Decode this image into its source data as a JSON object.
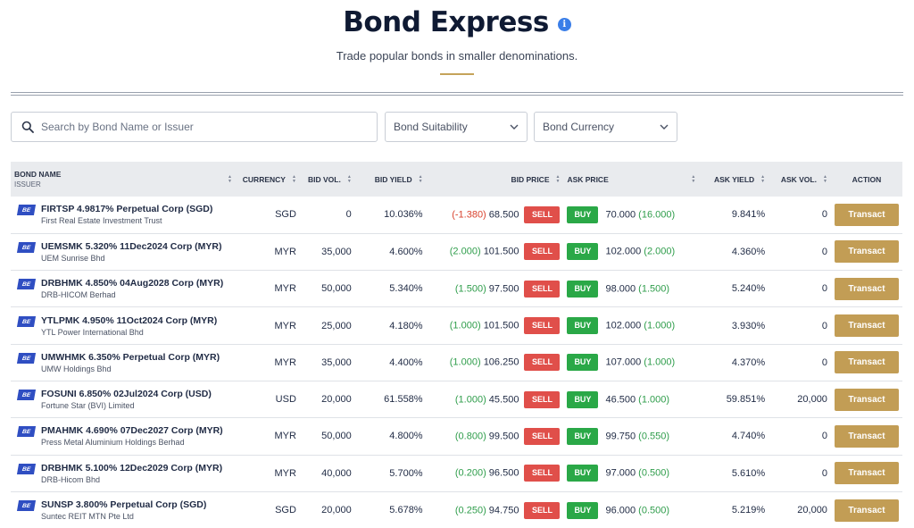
{
  "header": {
    "title": "Bond Express",
    "info_icon": "i",
    "subtitle": "Trade popular bonds in smaller denominations."
  },
  "filters": {
    "search_placeholder": "Search by Bond Name or Issuer",
    "suitability_label": "Bond Suitability",
    "currency_label": "Bond Currency"
  },
  "table": {
    "columns": {
      "bond_name": "BOND NAME",
      "issuer": "ISSUER",
      "currency": "CURRENCY",
      "bid_vol": "BID VOL.",
      "bid_yield": "BID YIELD",
      "bid_price": "BID PRICE",
      "ask_price": "ASK PRICE",
      "ask_yield": "ASK YIELD",
      "ask_vol": "ASK VOL.",
      "action": "ACTION"
    },
    "badge": "BE",
    "sell_label": "SELL",
    "buy_label": "BUY",
    "transact_label": "Transact",
    "rows": [
      {
        "name": "FIRTSP 4.9817% Perpetual Corp (SGD)",
        "issuer": "First Real Estate Investment Trust",
        "currency": "SGD",
        "bid_vol": "0",
        "bid_yield": "10.036%",
        "bid_change": "(-1.380)",
        "bid_change_dir": "neg",
        "bid_price": "68.500",
        "ask_price": "70.000",
        "ask_change": "(16.000)",
        "ask_yield": "9.841%",
        "ask_vol": "0"
      },
      {
        "name": "UEMSMK 5.320% 11Dec2024 Corp (MYR)",
        "issuer": "UEM Sunrise Bhd",
        "currency": "MYR",
        "bid_vol": "35,000",
        "bid_yield": "4.600%",
        "bid_change": "(2.000)",
        "bid_change_dir": "pos",
        "bid_price": "101.500",
        "ask_price": "102.000",
        "ask_change": "(2.000)",
        "ask_yield": "4.360%",
        "ask_vol": "0"
      },
      {
        "name": "DRBHMK 4.850% 04Aug2028 Corp (MYR)",
        "issuer": "DRB-HICOM Berhad",
        "currency": "MYR",
        "bid_vol": "50,000",
        "bid_yield": "5.340%",
        "bid_change": "(1.500)",
        "bid_change_dir": "pos",
        "bid_price": "97.500",
        "ask_price": "98.000",
        "ask_change": "(1.500)",
        "ask_yield": "5.240%",
        "ask_vol": "0"
      },
      {
        "name": "YTLPMK 4.950% 11Oct2024 Corp (MYR)",
        "issuer": "YTL Power International Bhd",
        "currency": "MYR",
        "bid_vol": "25,000",
        "bid_yield": "4.180%",
        "bid_change": "(1.000)",
        "bid_change_dir": "pos",
        "bid_price": "101.500",
        "ask_price": "102.000",
        "ask_change": "(1.000)",
        "ask_yield": "3.930%",
        "ask_vol": "0"
      },
      {
        "name": "UMWHMK 6.350% Perpetual Corp (MYR)",
        "issuer": "UMW Holdings Bhd",
        "currency": "MYR",
        "bid_vol": "35,000",
        "bid_yield": "4.400%",
        "bid_change": "(1.000)",
        "bid_change_dir": "pos",
        "bid_price": "106.250",
        "ask_price": "107.000",
        "ask_change": "(1.000)",
        "ask_yield": "4.370%",
        "ask_vol": "0"
      },
      {
        "name": "FOSUNI 6.850% 02Jul2024 Corp (USD)",
        "issuer": "Fortune Star (BVI) Limited",
        "currency": "USD",
        "bid_vol": "20,000",
        "bid_yield": "61.558%",
        "bid_change": "(1.000)",
        "bid_change_dir": "pos",
        "bid_price": "45.500",
        "ask_price": "46.500",
        "ask_change": "(1.000)",
        "ask_yield": "59.851%",
        "ask_vol": "20,000"
      },
      {
        "name": "PMAHMK 4.690% 07Dec2027 Corp (MYR)",
        "issuer": "Press Metal Aluminium Holdings Berhad",
        "currency": "MYR",
        "bid_vol": "50,000",
        "bid_yield": "4.800%",
        "bid_change": "(0.800)",
        "bid_change_dir": "pos",
        "bid_price": "99.500",
        "ask_price": "99.750",
        "ask_change": "(0.550)",
        "ask_yield": "4.740%",
        "ask_vol": "0"
      },
      {
        "name": "DRBHMK 5.100% 12Dec2029 Corp (MYR)",
        "issuer": "DRB-Hicom Bhd",
        "currency": "MYR",
        "bid_vol": "40,000",
        "bid_yield": "5.700%",
        "bid_change": "(0.200)",
        "bid_change_dir": "pos",
        "bid_price": "96.500",
        "ask_price": "97.000",
        "ask_change": "(0.500)",
        "ask_yield": "5.610%",
        "ask_vol": "0"
      },
      {
        "name": "SUNSP 3.800% Perpetual Corp (SGD)",
        "issuer": "Suntec REIT MTN Pte Ltd",
        "currency": "SGD",
        "bid_vol": "20,000",
        "bid_yield": "5.678%",
        "bid_change": "(0.250)",
        "bid_change_dir": "pos",
        "bid_price": "94.750",
        "ask_price": "96.000",
        "ask_change": "(0.500)",
        "ask_yield": "5.219%",
        "ask_vol": "20,000"
      }
    ]
  },
  "colors": {
    "accent_gold": "#c29d55",
    "sell_red": "#e04f4a",
    "buy_green": "#2aa847",
    "badge_blue": "#2f4ec2",
    "info_blue": "#3a7ee8"
  }
}
